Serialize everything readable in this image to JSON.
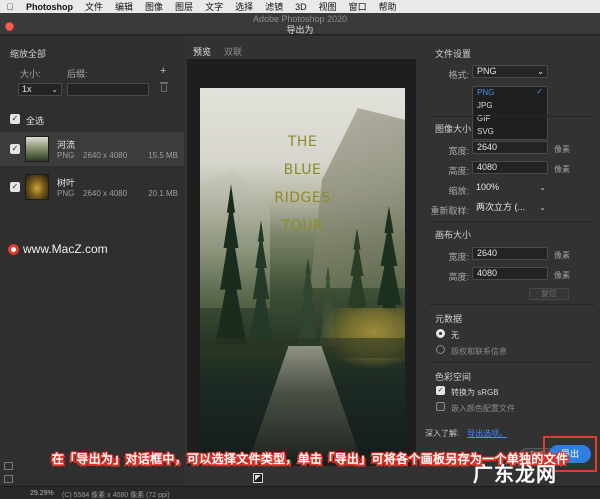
{
  "menubar": {
    "app": "Photoshop",
    "items": [
      "文件",
      "编辑",
      "图像",
      "图层",
      "文字",
      "选择",
      "滤镜",
      "3D",
      "视图",
      "窗口",
      "帮助"
    ]
  },
  "window": {
    "background_title": "Adobe Photoshop 2020",
    "dialog_title": "导出为"
  },
  "left_panel": {
    "section_title": "缩放全部",
    "size_label": "大小:",
    "suffix_label": "后缀:",
    "scale_value": "1x",
    "suffix_value": "",
    "select_all_label": "全选",
    "assets": [
      {
        "name": "河流",
        "format": "PNG",
        "dims": "2640 x 4080",
        "size": "15.5 MB"
      },
      {
        "name": "树叶",
        "format": "PNG",
        "dims": "2640 x 4080",
        "size": "20.1 MB"
      }
    ]
  },
  "watermark": "www.MacZ.com",
  "preview": {
    "tabs": [
      "预览",
      "双联"
    ],
    "photo_title_lines": [
      "THE",
      "BLUE",
      "RIDGES",
      "TOUR"
    ]
  },
  "right_panel": {
    "file_settings": {
      "title": "文件设置",
      "format_label": "格式:",
      "format_value": "PNG",
      "options": [
        "PNG",
        "JPG",
        "GIF",
        "SVG"
      ]
    },
    "image_size": {
      "title": "图像大小",
      "width_label": "宽度:",
      "width_value": "2640",
      "height_label": "高度:",
      "height_value": "4080",
      "scale_label": "缩放:",
      "scale_value": "100%",
      "resample_label": "重新取样:",
      "resample_value": "两次立方 (...",
      "unit": "像素"
    },
    "canvas_size": {
      "title": "画布大小",
      "width_label": "宽度:",
      "width_value": "2640",
      "height_label": "高度:",
      "height_value": "4080",
      "unit": "像素",
      "restore_label": "复位"
    },
    "metadata": {
      "title": "元数据",
      "option_none": "无",
      "option_copyright": "版权和联系信息"
    },
    "color_space": {
      "title": "色彩空间",
      "convert_srgb": "转换为 sRGB",
      "embed_profile": "嵌入颜色配置文件"
    },
    "learn_more": "深入了解:",
    "learn_link": "导出选项。",
    "cancel_label": "取消",
    "export_label": "导出"
  },
  "caption": "在「导出为」对话框中，可以选择文件类型，单击「导出」可将各个画板另存为一个单独的文件",
  "statusbar": {
    "zoom": "29.29%",
    "info": "(C) 5584 像素 x 4080 像素 (72 ppi)"
  },
  "site_mark": "广东龙网",
  "colors": {
    "accent": "#2e7fe0",
    "highlight": "#e23b2e",
    "title_text": "#8e8a2c"
  }
}
